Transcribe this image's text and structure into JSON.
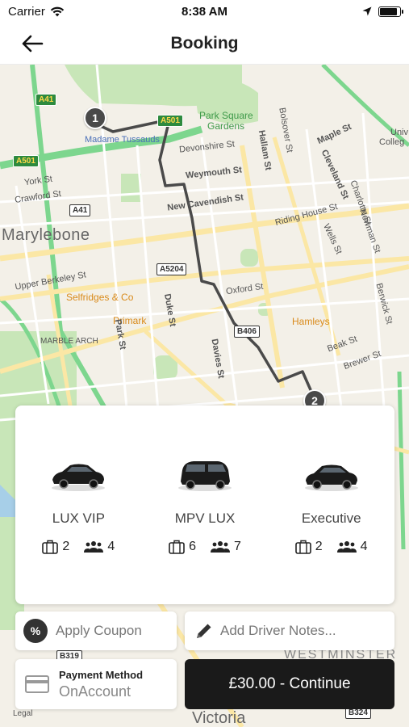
{
  "status_bar": {
    "carrier": "Carrier",
    "time": "8:38 AM"
  },
  "nav": {
    "title": "Booking"
  },
  "map": {
    "labels": {
      "marylebone": "Marylebone",
      "park_square": "Park Square",
      "gardens": "Gardens",
      "madame_tussauds": "Madame Tussauds",
      "devonshire": "Devonshire St",
      "weymouth": "Weymouth St",
      "new_cavendish": "New Cavendish St",
      "hallam": "Hallam St",
      "bolsover": "Bolsover St",
      "maple": "Maple St",
      "cleveland": "Cleveland St",
      "riding_house": "Riding House St",
      "york": "York St",
      "crawford": "Crawford St",
      "upper_berkeley": "Upper Berkeley St",
      "selfridges": "Selfridges & Co",
      "primark": "Primark",
      "marble_arch": "MARBLE ARCH",
      "oxford": "Oxford St",
      "duke": "Duke St",
      "davies": "Davies St",
      "park_st": "Park St",
      "hamleys": "Hamleys",
      "wells": "Wells St",
      "berwick": "Berwick St",
      "newman": "Newman St",
      "charlotte": "Charlotte St",
      "beak": "Beak St",
      "brewer": "Brewer St",
      "univ": "Univ",
      "college": "Colleg",
      "westminster": "WESTMINSTER",
      "victoria": "Victoria",
      "legal": "Legal"
    },
    "road_badges": {
      "a41_top": "A41",
      "a501_left": "A501",
      "a501_mid": "A501",
      "a41_mid": "A41",
      "a5204": "A5204",
      "b406": "B406",
      "b319": "B319",
      "b324": "B324"
    },
    "pins": {
      "start": "1",
      "end": "2"
    }
  },
  "vehicles": [
    {
      "name": "LUX VIP",
      "luggage": "2",
      "passengers": "4"
    },
    {
      "name": "MPV LUX",
      "luggage": "6",
      "passengers": "7"
    },
    {
      "name": "Executive",
      "luggage": "2",
      "passengers": "4"
    }
  ],
  "actions": {
    "coupon_icon": "%",
    "coupon_label": "Apply Coupon",
    "notes_label": "Add Driver Notes...",
    "payment_title": "Payment Method",
    "payment_value": "OnAccount",
    "continue_label": "£30.00 - Continue"
  },
  "colors": {
    "route": "#4a4a4a",
    "primary_button": "#1a1a1a",
    "park_green": "#c8e6b8",
    "road_yellow": "#fbe7a5",
    "motorway_green": "#7dd68e"
  },
  "icons": {
    "back": "arrow-left-icon",
    "wifi": "wifi-icon",
    "location": "location-arrow-icon",
    "battery": "battery-icon",
    "luggage": "luggage-icon",
    "passengers": "people-icon",
    "coupon": "percent-icon",
    "notes": "pencil-icon",
    "payment": "credit-card-icon"
  }
}
